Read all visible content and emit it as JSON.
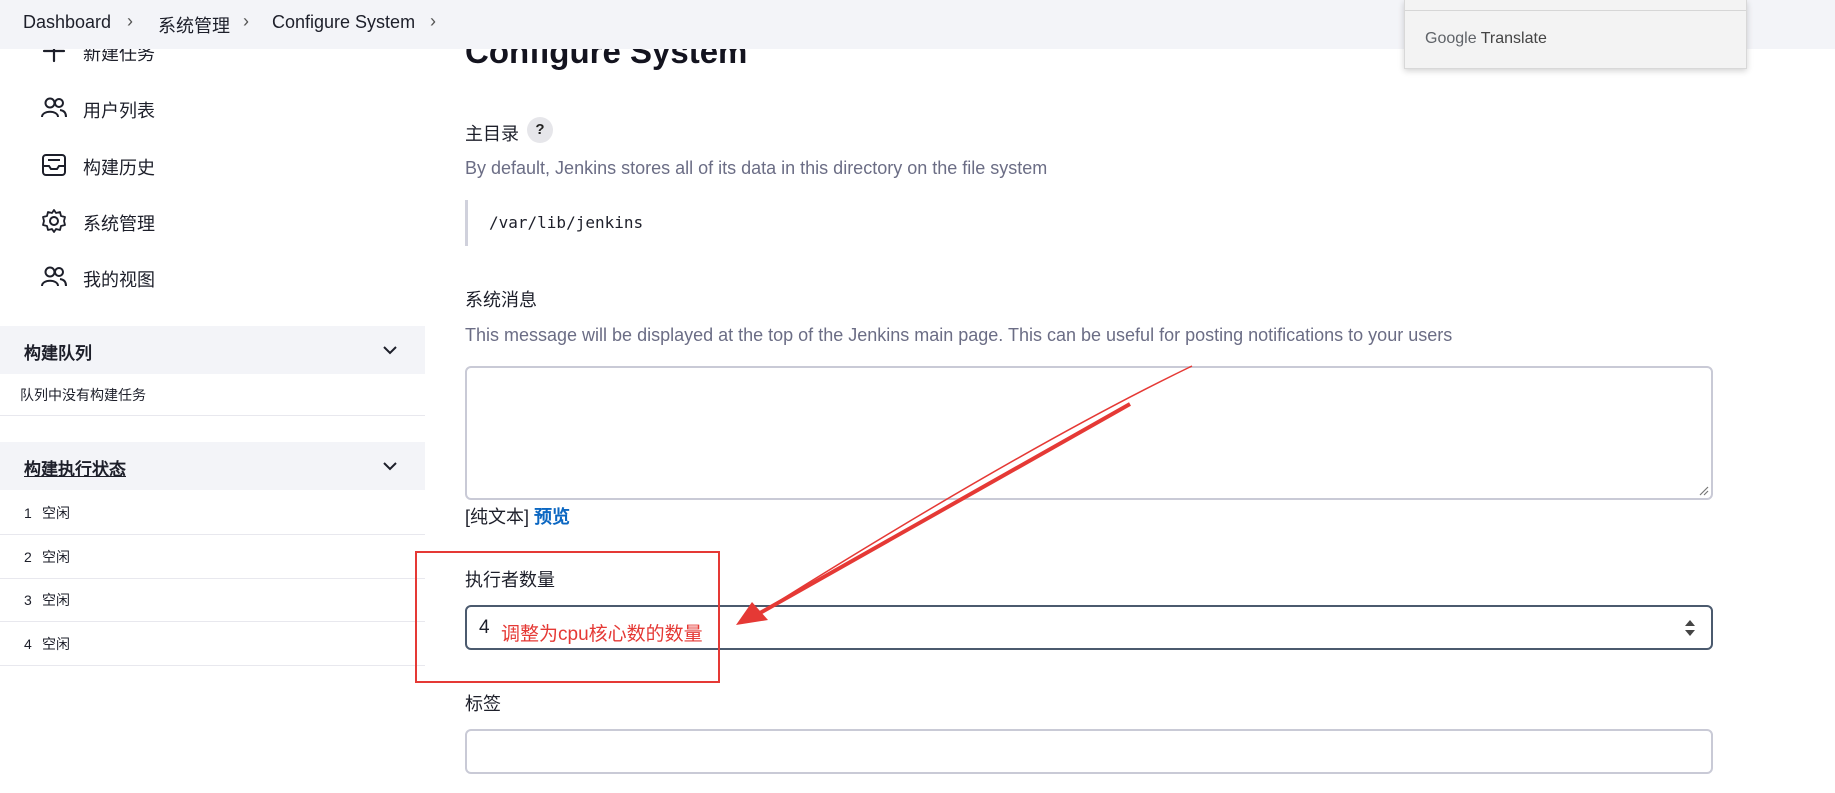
{
  "breadcrumb": [
    "Dashboard",
    "系统管理",
    "Configure System"
  ],
  "translate_popup": {
    "google": "Google",
    "label": "Translate"
  },
  "sidebar": {
    "items": [
      {
        "label": "新建任务",
        "icon": "plus-icon"
      },
      {
        "label": "用户列表",
        "icon": "users-icon"
      },
      {
        "label": "构建历史",
        "icon": "inbox-icon"
      },
      {
        "label": "系统管理",
        "icon": "gear-icon"
      },
      {
        "label": "我的视图",
        "icon": "users-icon"
      }
    ],
    "build_queue": {
      "title": "构建队列",
      "empty_text": "队列中没有构建任务"
    },
    "executor_status": {
      "title": "构建执行状态",
      "executors": [
        {
          "num": "1",
          "status": "空闲"
        },
        {
          "num": "2",
          "status": "空闲"
        },
        {
          "num": "3",
          "status": "空闲"
        },
        {
          "num": "4",
          "status": "空闲"
        }
      ]
    }
  },
  "main": {
    "title": "Configure System",
    "home_dir": {
      "label": "主目录",
      "help": "?",
      "description": "By default, Jenkins stores all of its data in this directory on the file system",
      "path": "/var/lib/jenkins"
    },
    "system_message": {
      "label": "系统消息",
      "description": "This message will be displayed at the top of the Jenkins main page. This can be useful for posting notifications to your users",
      "value": "",
      "markup_prefix": "[纯文本]",
      "preview_link": "预览"
    },
    "executors": {
      "label": "执行者数量",
      "value": "4"
    },
    "labels": {
      "label": "标签",
      "value": ""
    }
  },
  "annotation": {
    "text": "调整为cpu核心数的数量",
    "color": "#e53935"
  },
  "colors": {
    "accent_link": "#0b67c2",
    "panel_bg": "#f3f4f8",
    "annotation": "#e53935"
  }
}
